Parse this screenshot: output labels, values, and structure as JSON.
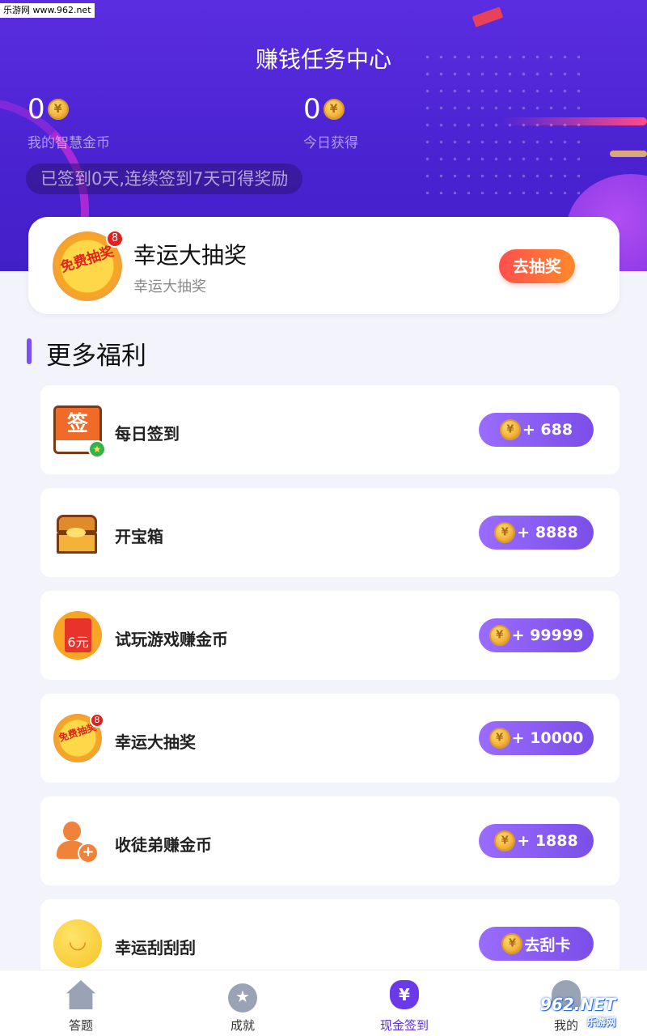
{
  "watermark_top": "乐游网 www.962.net",
  "header": {
    "title": "赚钱任务中心",
    "my_coins_value": "0",
    "my_coins_label": "我的智慧金币",
    "today_value": "0",
    "today_label": "今日获得",
    "sign_status": "已签到0天,连续签到7天可得奖励"
  },
  "lottery_card": {
    "icon_text": "免费抽奖",
    "badge": "8",
    "title": "幸运大抽奖",
    "subtitle": "幸运大抽奖",
    "button": "去抽奖"
  },
  "section": {
    "title": "更多福利"
  },
  "tasks": [
    {
      "name": "每日签到",
      "reward": "+ 688",
      "icon": "calendar-sign-icon",
      "icon_text": "签"
    },
    {
      "name": "开宝箱",
      "reward": "+ 8888",
      "icon": "treasure-chest-icon"
    },
    {
      "name": "试玩游戏赚金币",
      "reward": "+ 99999",
      "icon": "red-envelope-icon",
      "icon_text": "6元"
    },
    {
      "name": "幸运大抽奖",
      "reward": "+ 10000",
      "icon": "lucky-wheel-icon",
      "icon_text": "免费抽奖",
      "badge": "8"
    },
    {
      "name": "收徒弟赚金币",
      "reward": "+ 1888",
      "icon": "add-user-icon"
    },
    {
      "name": "幸运刮刮刮",
      "reward": "去刮卡",
      "icon": "smiley-coin-icon"
    }
  ],
  "tabbar": [
    {
      "label": "答题",
      "icon": "home-icon"
    },
    {
      "label": "成就",
      "icon": "medal-icon"
    },
    {
      "label": "现金签到",
      "icon": "money-bag-icon",
      "active": true
    },
    {
      "label": "我的",
      "icon": "person-icon"
    }
  ],
  "watermark_bottom": {
    "main": "962.NET",
    "sub": "乐游网"
  },
  "colors": {
    "header_bg": "#5a2ee0",
    "accent": "#7a4ee8",
    "go_button": "#ff6a3a"
  }
}
